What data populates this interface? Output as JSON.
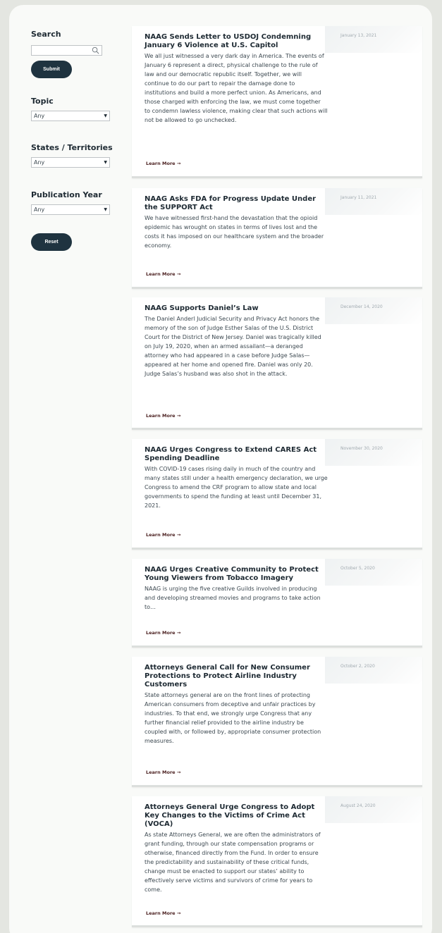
{
  "sidebar": {
    "search_label": "Search",
    "search_value": "",
    "submit_label": "Submit",
    "topic_label": "Topic",
    "topic_value": "Any",
    "states_label": "States / Territories",
    "states_value": "Any",
    "year_label": "Publication Year",
    "year_value": "Any",
    "reset_label": "Reset"
  },
  "learn_more": "Learn More →",
  "articles": [
    {
      "title": "NAAG Sends Letter to USDOJ Condemning January 6 Violence at U.S. Capitol",
      "text": "We all just witnessed a very dark day in America. The events of January 6 represent a direct, physical challenge to the rule of law and our democratic republic itself. Together, we will continue to do our part to repair the damage done to institutions and build a more perfect union. As Americans, and those charged with enforcing the law, we must come together to condemn lawless violence, making clear that such actions will not be allowed to go unchecked.",
      "date": "January 13, 2021"
    },
    {
      "title": "NAAG Asks FDA for Progress Update Under the SUPPORT Act",
      "text": "We have witnessed first-hand the devastation that the opioid epidemic has wrought on states in terms of lives lost and the costs it has imposed on our healthcare system and the broader economy.",
      "date": "January 11, 2021"
    },
    {
      "title": "NAAG Supports Daniel’s Law",
      "text": "The Daniel Anderl Judicial Security and Privacy Act honors the memory of the son of Judge Esther Salas of the U.S. District Court for the District of New Jersey. Daniel was tragically killed on July 19, 2020, when an armed assailant—a deranged attorney who had appeared in a case before Judge Salas—appeared at her home and opened fire. Daniel was only 20. Judge Salas’s husband was also shot in the attack.",
      "date": "December 14, 2020"
    },
    {
      "title": "NAAG Urges Congress to Extend CARES Act Spending Deadline",
      "text": "With COVID-19 cases rising daily in much of the country and many states still under a health emergency declaration, we urge Congress to amend the CRF program to allow state and local governments to spend the funding at least until December 31, 2021.",
      "date": "November 30, 2020"
    },
    {
      "title": "NAAG Urges Creative Community to Protect Young Viewers from Tobacco Imagery",
      "text": "NAAG is urging the five creative Guilds involved in producing and developing streamed movies and programs to take action to…",
      "date": "October 5, 2020"
    },
    {
      "title": "Attorneys General Call for New Consumer Protections to Protect Airline Industry Customers",
      "text": "State attorneys general are on the front lines of protecting American consumers from deceptive and unfair practices by industries. To that end, we strongly urge Congress that any further financial relief provided to the airline industry be coupled with, or followed by, appropriate consumer protection measures.",
      "date": "October 2, 2020"
    },
    {
      "title": "Attorneys General Urge Congress to Adopt Key Changes to the Victims of Crime Act (VOCA)",
      "text": "As state Attorneys General, we are often the administrators of grant funding, through our state compensation programs or otherwise, financed directly from the Fund. In order to ensure the predictability and sustainability of these critical funds, change must be enacted to support our states’ ability to effectively serve victims and survivors of crime for years to come.",
      "date": "August 24, 2020"
    }
  ]
}
